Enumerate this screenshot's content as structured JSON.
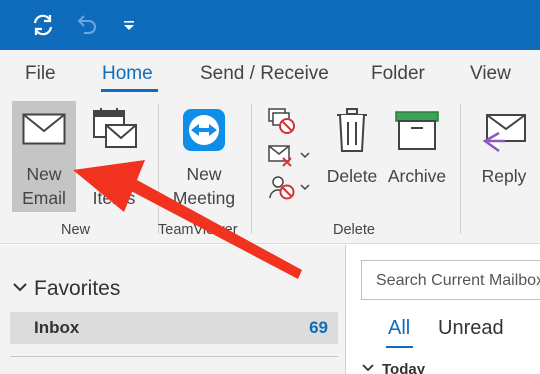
{
  "titlebar": {
    "color": "#0f6cbd",
    "buttons": [
      {
        "icon": "sync-icon"
      },
      {
        "icon": "undo-icon"
      },
      {
        "icon": "customize-toolbar-icon"
      }
    ]
  },
  "tabs": [
    {
      "label": "File"
    },
    {
      "label": "Home",
      "active": true
    },
    {
      "label": "Send / Receive"
    },
    {
      "label": "Folder"
    },
    {
      "label": "View"
    }
  ],
  "ribbon": {
    "new_email": {
      "line1": "New",
      "line2": "Email",
      "icon": "envelope-icon"
    },
    "new_items": {
      "line1": "New",
      "line2": "Items",
      "icon": "new-items-icon"
    },
    "new_meeting": {
      "line1": "New",
      "line2": "Meeting",
      "icon": "teamviewer-icon"
    },
    "delete": {
      "label": "Delete",
      "icon": "trash-icon"
    },
    "archive": {
      "label": "Archive",
      "icon": "archive-icon"
    },
    "reply": {
      "label": "Reply",
      "icon": "reply-icon"
    },
    "small_icons": [
      "ignore-icon",
      "clean-up-icon",
      "junk-icon"
    ],
    "groups": {
      "new": "New",
      "teamviewer": "TeamViewer",
      "delete": "Delete"
    }
  },
  "folders": {
    "favorites_label": "Favorites",
    "inbox_label": "Inbox",
    "inbox_count": "69"
  },
  "mail_list": {
    "search_placeholder": "Search Current Mailbox",
    "filter_all": "All",
    "filter_unread": "Unread",
    "today_label": "Today"
  },
  "annotation": {
    "color": "#f0321e",
    "icon": "pointer-arrow"
  }
}
